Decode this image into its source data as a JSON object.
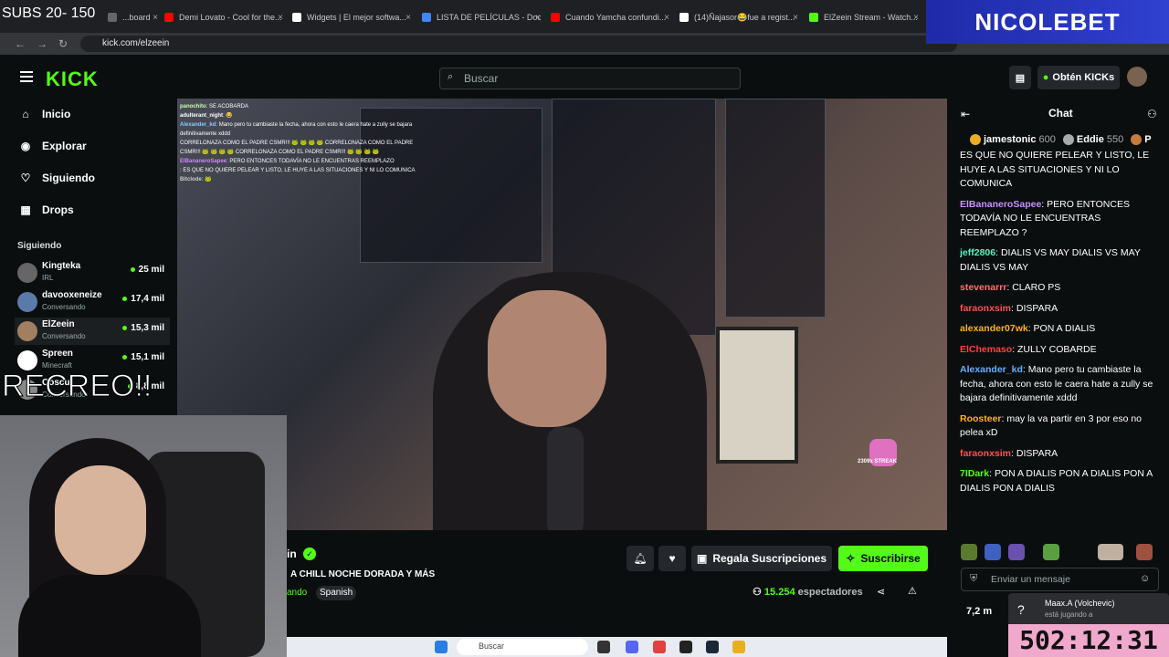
{
  "overlay_subs": "SUBS 20- 150",
  "overlay_recreo": "RECREO!!",
  "overlay_nicolebet": "NICOLEBET",
  "overlay_timer": "502:12:31",
  "browser": {
    "tabs": [
      {
        "label": "...board",
        "color": "#666"
      },
      {
        "label": "Demi Lovato - Cool for the...",
        "color": "#ff0000"
      },
      {
        "label": "Widgets | El mejor softwa...",
        "color": "#ffffff"
      },
      {
        "label": "LISTA DE PELÍCULAS - Doc...",
        "color": "#4285f4"
      },
      {
        "label": "Cuando Yamcha confundi...",
        "color": "#ff0000"
      },
      {
        "label": "(14)Ñajasor😂fue a regist...",
        "color": "#ffffff"
      },
      {
        "label": "ElZeein Stream - Watch...",
        "color": "#53fc18"
      }
    ],
    "url": "kick.com/elzeein"
  },
  "header": {
    "logo": "KICK",
    "search_placeholder": "Buscar",
    "get_kicks": "Obtén KICKs"
  },
  "sidebar": {
    "nav": [
      {
        "label": "Inicio",
        "icon": "home-icon"
      },
      {
        "label": "Explorar",
        "icon": "compass-icon"
      },
      {
        "label": "Siguiendo",
        "icon": "heart-icon"
      },
      {
        "label": "Drops",
        "icon": "gift-icon"
      }
    ],
    "following_heading": "Siguiendo",
    "following": [
      {
        "name": "Kingteka",
        "category": "IRL",
        "viewers": "25 mil",
        "color": "#666"
      },
      {
        "name": "davooxeneize",
        "category": "Conversando",
        "viewers": "17,4 mil",
        "color": "#5a7aaa"
      },
      {
        "name": "ElZeein",
        "category": "Conversando",
        "viewers": "15,3 mil",
        "color": "#a08060"
      },
      {
        "name": "Spreen",
        "category": "Minecraft",
        "viewers": "15,1 mil",
        "color": "#ffffff"
      },
      {
        "name": "Coscu",
        "category": "Conversando",
        "viewers": "8,8 mil",
        "color": "#888"
      }
    ]
  },
  "video_overlay_chat": [
    {
      "user": "panochito",
      "text": ": SE ACOBARDA",
      "color": "#cfa"
    },
    {
      "user": "adulterant_night",
      "text": ": 😂",
      "color": "#fff"
    },
    {
      "user": "Alexander_kd",
      "text": ": Mano pero tu cambiaste la fecha, ahora con esto le caera hate a zully se bajara definitivamente xddd",
      "color": "#8cf"
    },
    {
      "user": "",
      "text": "CORRELONAZA COMO EL PADRE CSMR!!! 🐸 🐸 🐸 🐸 CORRELONAZA COMO EL PADRE CSMR!!! 🐸 🐸 🐸 🐸 CORRELONAZA COMO EL PADRE CSMR!!! 🐸 🐸 🐸 🐸",
      "color": "#fff"
    },
    {
      "user": "ElBananeroSapee",
      "text": ": PERO ENTONCES TODAVÍA NO LE ENCUENTRAS REEMPLAZO",
      "color": "#c8f"
    },
    {
      "user": "",
      "text": ": ES QUE NO QUIERE PELEAR Y LISTO, LE HUYE A LAS SITUACIONES Y NI LO COMUNICA",
      "color": "#fff"
    },
    {
      "user": "Bitclode",
      "text": ": 🐸",
      "color": "#ccc"
    }
  ],
  "video_streak": "2309x STREAK",
  "stream_info": {
    "name_fragment": "in",
    "title": "A CHILL NOCHE DORADA Y MÁS",
    "category_fragment": "ando",
    "tag": "Spanish",
    "gift_label": "Regala Suscripciones",
    "subscribe_label": "Suscribirse",
    "viewers_count": "15.254",
    "viewers_label": "espectadores"
  },
  "chat": {
    "title": "Chat",
    "pinned": [
      {
        "name": "jamestonic",
        "amount": "600",
        "badge": "#e8b020"
      },
      {
        "name": "Eddie",
        "amount": "550",
        "badge": "#aaa"
      },
      {
        "name": "P",
        "amount": "",
        "badge": "#c87a40"
      }
    ],
    "messages": [
      {
        "user": "",
        "user_color": "#53fc18",
        "text": "ES QUE NO QUIERE PELEAR Y LISTO, LE HUYE A LAS SITUACIONES Y NI LO COMUNICA"
      },
      {
        "user": "ElBananeroSapee",
        "user_color": "#c890ff",
        "text": ": PERO ENTONCES TODAVÍA NO LE ENCUENTRAS REEMPLAZO ?"
      },
      {
        "user": "jeff2806",
        "user_color": "#5cf0c0",
        "text": ": DIALIS VS MAY DIALIS VS MAY DIALIS VS MAY"
      },
      {
        "user": "stevenarrr",
        "user_color": "#ff6f6f",
        "text": ": CLARO PS"
      },
      {
        "user": "faraonxsim",
        "user_color": "#ff5050",
        "text": ": DISPARA"
      },
      {
        "user": "alexander07wk",
        "user_color": "#ffb020",
        "text": ": PON A DIALIS"
      },
      {
        "user": "ElChemaso",
        "user_color": "#ff4040",
        "text": ": ZULLY COBARDE"
      },
      {
        "user": "Alexander_kd",
        "user_color": "#60b0ff",
        "text": ": Mano pero tu cambiaste la fecha, ahora con esto le caera hate a zully se bajara definitivamente xddd"
      },
      {
        "user": "Roosteer",
        "user_color": "#ffb020",
        "text": ": may la va partir en 3 por eso no pelea xD"
      },
      {
        "user": "faraonxsim",
        "user_color": "#ff5050",
        "text": ": DISPARA"
      },
      {
        "user": "7IDark",
        "user_color": "#53fc18",
        "text": ": PON A DIALIS PON A DIALIS PON A DIALIS PON A DIALIS"
      }
    ],
    "input_placeholder": "Enviar un mensaje",
    "footer_viewers": "7,2 m"
  },
  "notification": {
    "title": "Maax.A (Volchevic)",
    "sub": "está jugando a"
  },
  "taskbar_search": "Buscar"
}
